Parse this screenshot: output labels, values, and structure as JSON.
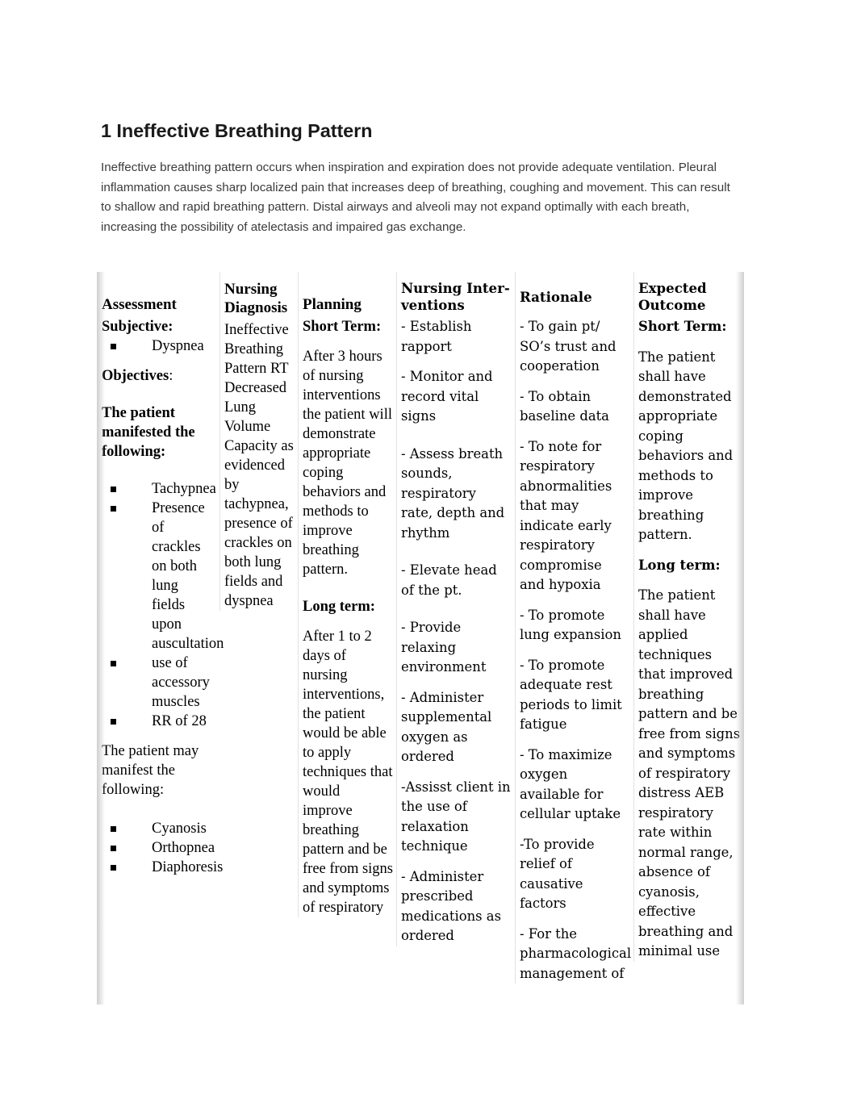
{
  "document": {
    "title": "1 Ineffective Breathing Pattern",
    "intro": "Ineffective breathing pattern occurs when inspiration and expiration does not provide adequate ventilation. Pleural inflammation causes sharp localized pain that increases deep of breathing, coughing and movement. This can result to shallow and rapid breathing pattern. Distal airways and alveoli may not expand optimally with each breath, increasing the possibility of atelectasis and impaired gas exchange."
  },
  "table": {
    "headers": {
      "assessment": "Assessment",
      "diagnosis": "Nursing Diagnosis",
      "planning": "Planning",
      "interventions": "Nursing Inter-ventions",
      "rationale": "Rationale",
      "outcome": "Expected Outcome"
    },
    "assessment": {
      "subjective_label": "Subjective:",
      "subjective_items": [
        "Dyspnea"
      ],
      "objectives_label": "Objectives",
      "objectives_label_colon": ":",
      "manifested_label": "The patient manifested the following:",
      "manifested_items": [
        "Tachypnea",
        "Presence of crackles on both lung fields upon auscultation",
        "use of accessory muscles",
        "RR of 28"
      ],
      "may_manifest_label": "The patient may manifest the following:",
      "may_manifest_items": [
        "Cyanosis",
        "Orthopnea",
        "Diaphoresis"
      ]
    },
    "diagnosis": {
      "text": "Ineffective Breathing Pattern RT Decreased Lung Volume Capacity as evidenced by tachypnea, presence of crackles on both lung fields and dyspnea"
    },
    "planning": {
      "short_term_label": "Short Term:",
      "short_term_text": "After 3 hours of nursing interventions the patient will demonstrate appropriate coping behaviors and methods to improve breathing pattern.",
      "long_term_label": "Long term:",
      "long_term_text": "After 1 to 2 days of nursing interventions, the patient would be able to apply techniques that would improve breathing pattern and be free from signs and symptoms of respiratory"
    },
    "interventions": [
      "- Establish rapport",
      "- Monitor and record vital signs",
      "- Assess breath sounds, respiratory rate, depth and rhythm",
      "- Elevate head of the pt.",
      "- Provide relaxing environment",
      "- Administer supplemental oxygen as ordered",
      "-Assisst client in the use of relaxation technique",
      "- Administer prescribed medications as ordered"
    ],
    "rationale": [
      "- To gain pt/ SO’s trust and cooperation",
      "- To obtain baseline data",
      "- To note for respiratory abnormalities that may indicate early respiratory compromise and hypoxia",
      "- To promote lung expansion",
      "- To promote adequate rest periods to limit fatigue",
      "- To maximize oxygen available for cellular uptake",
      "-To provide relief of causative factors",
      "- For the pharmacological management of"
    ],
    "outcome": {
      "short_term_label": "Short Term:",
      "short_term_text": "The patient shall have demonstrated appropriate coping behaviors and methods to improve breathing pattern.",
      "long_term_label": "Long term:",
      "long_term_text": "The patient shall have applied techniques that improved breathing pattern and be free from signs and symptoms of respiratory distress AEB respiratory rate within normal range, absence of cyanosis, effective breathing and minimal use"
    }
  }
}
